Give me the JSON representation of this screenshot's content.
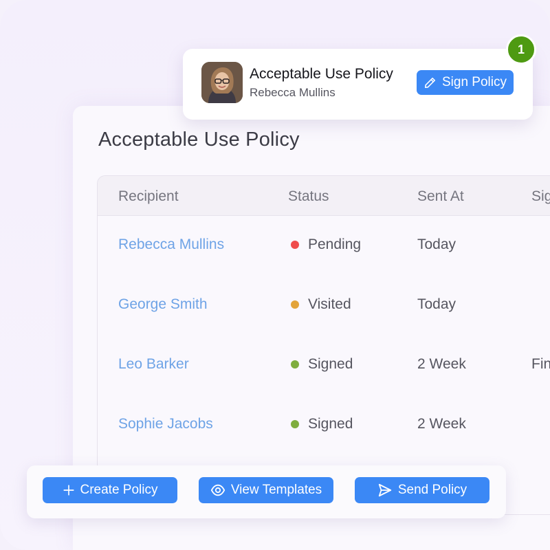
{
  "popup": {
    "title": "Acceptable Use Policy",
    "subtitle": "Rebecca Mullins",
    "sign_button": "Sign Policy",
    "badge_count": "1",
    "avatar_icon": "person-avatar"
  },
  "page": {
    "title": "Acceptable Use Policy"
  },
  "table": {
    "columns": [
      "Recipient",
      "Status",
      "Sent At",
      "Sig"
    ],
    "rows": [
      {
        "recipient": "Rebecca Mullins",
        "status": "Pending",
        "status_color": "#ef4c4c",
        "sent_at": "Today",
        "signed": ""
      },
      {
        "recipient": "George Smith",
        "status": "Visited",
        "status_color": "#e3a43a",
        "sent_at": "Today",
        "signed": ""
      },
      {
        "recipient": "Leo Barker",
        "status": "Signed",
        "status_color": "#7fad3e",
        "sent_at": "2 Week",
        "signed": "Fin"
      },
      {
        "recipient": "Sophie Jacobs",
        "status": "Signed",
        "status_color": "#7fad3e",
        "sent_at": "2 Week",
        "signed": ""
      }
    ]
  },
  "actions": {
    "create_label": "Create Policy",
    "view_label": "View Templates",
    "send_label": "Send Policy"
  },
  "colors": {
    "accent": "#3b88f5",
    "badge": "#4e9a12",
    "link": "#6ea3e6"
  }
}
